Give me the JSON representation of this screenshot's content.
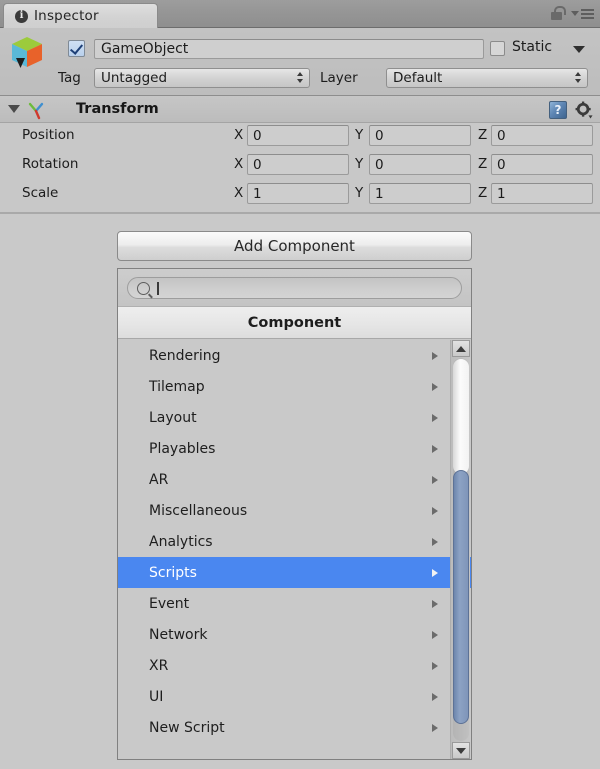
{
  "window": {
    "tab_label": "Inspector",
    "tab_icon": "info-icon",
    "lock_icon": "lock-open-icon",
    "menu_icon": "hamburger-menu-icon"
  },
  "gameobject": {
    "icon": "gameobject-cube-icon",
    "enabled_checkbox": "checked",
    "name": "GameObject",
    "static_label": "Static",
    "static_checked": false,
    "tag_label": "Tag",
    "tag_value": "Untagged",
    "layer_label": "Layer",
    "layer_value": "Default"
  },
  "transform": {
    "title": "Transform",
    "icon": "transform-axis-icon",
    "help_icon": "help-book-icon",
    "settings_icon": "gear-icon",
    "rows": [
      {
        "label": "Position",
        "x": "0",
        "y": "0",
        "z": "0"
      },
      {
        "label": "Rotation",
        "x": "0",
        "y": "0",
        "z": "0"
      },
      {
        "label": "Scale",
        "x": "1",
        "y": "1",
        "z": "1"
      }
    ],
    "axis_labels": {
      "x": "X",
      "y": "Y",
      "z": "Z"
    }
  },
  "add_component": {
    "button_label": "Add Component",
    "search_placeholder": "",
    "search_value": "",
    "search_icon": "search-icon",
    "popup_title": "Component",
    "selected_item": "Scripts",
    "highlight_color": "#4a87f0",
    "items": [
      {
        "label": "Rendering",
        "has_submenu": true,
        "selected": false
      },
      {
        "label": "Tilemap",
        "has_submenu": true,
        "selected": false
      },
      {
        "label": "Layout",
        "has_submenu": true,
        "selected": false
      },
      {
        "label": "Playables",
        "has_submenu": true,
        "selected": false
      },
      {
        "label": "AR",
        "has_submenu": true,
        "selected": false
      },
      {
        "label": "Miscellaneous",
        "has_submenu": true,
        "selected": false
      },
      {
        "label": "Analytics",
        "has_submenu": true,
        "selected": false
      },
      {
        "label": "Scripts",
        "has_submenu": true,
        "selected": true
      },
      {
        "label": "Event",
        "has_submenu": true,
        "selected": false
      },
      {
        "label": "Network",
        "has_submenu": true,
        "selected": false
      },
      {
        "label": "XR",
        "has_submenu": true,
        "selected": false
      },
      {
        "label": "UI",
        "has_submenu": true,
        "selected": false
      },
      {
        "label": "New Script",
        "has_submenu": true,
        "selected": false
      }
    ],
    "scrollbar": {
      "up_arrow": "scroll-up-icon",
      "down_arrow": "scroll-down-icon"
    }
  }
}
